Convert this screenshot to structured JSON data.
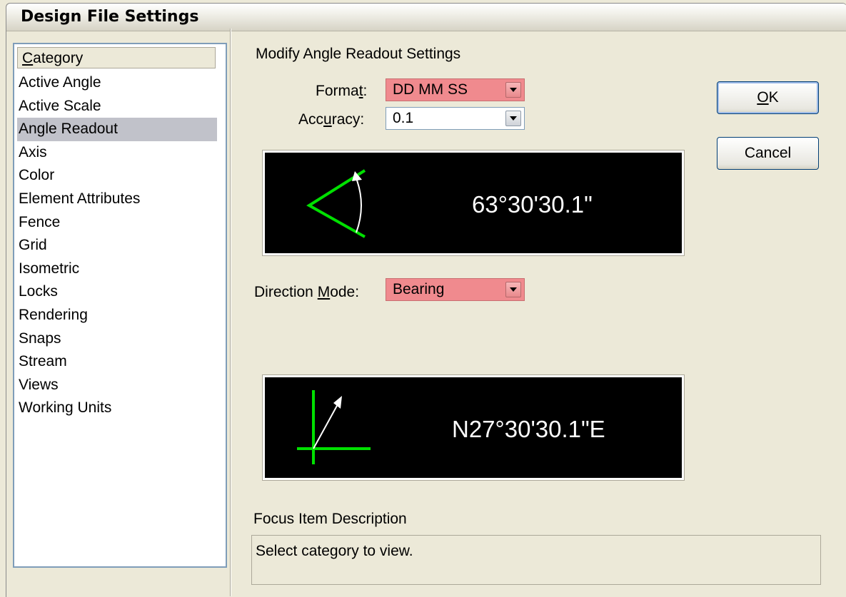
{
  "window": {
    "title": "Design File Settings"
  },
  "category": {
    "header": "Category",
    "header_mnemonic": "C",
    "header_rest": "ategory",
    "items": [
      "Active Angle",
      "Active Scale",
      "Angle Readout",
      "Axis",
      "Color",
      "Element Attributes",
      "Fence",
      "Grid",
      "Isometric",
      "Locks",
      "Rendering",
      "Snaps",
      "Stream",
      "Views",
      "Working Units"
    ],
    "selected": "Angle Readout"
  },
  "settings": {
    "heading": "Modify Angle Readout Settings",
    "format": {
      "label_pre": "Forma",
      "label_mnemonic": "t",
      "label_post": ":",
      "value": "DD MM SS"
    },
    "accuracy": {
      "label_pre": "Acc",
      "label_mnemonic": "u",
      "label_post": "racy:",
      "value": "0.1"
    },
    "direction": {
      "label_pre": "Direction ",
      "label_mnemonic": "M",
      "label_post": "ode:",
      "value": "Bearing"
    },
    "angle_preview": {
      "readout": "63°30'30.1\"",
      "icon": "angle-arc-icon"
    },
    "bearing_preview": {
      "readout": "N27°30'30.1\"E",
      "icon": "bearing-axes-icon"
    }
  },
  "buttons": {
    "ok_mnemonic": "O",
    "ok_rest": "K",
    "cancel": "Cancel"
  },
  "focus": {
    "label": "Focus Item Description",
    "text": "Select category to view."
  },
  "colors": {
    "preview_line": "#00e000",
    "highlight": "#f08a8e",
    "selected_row": "#c1c2ca"
  }
}
